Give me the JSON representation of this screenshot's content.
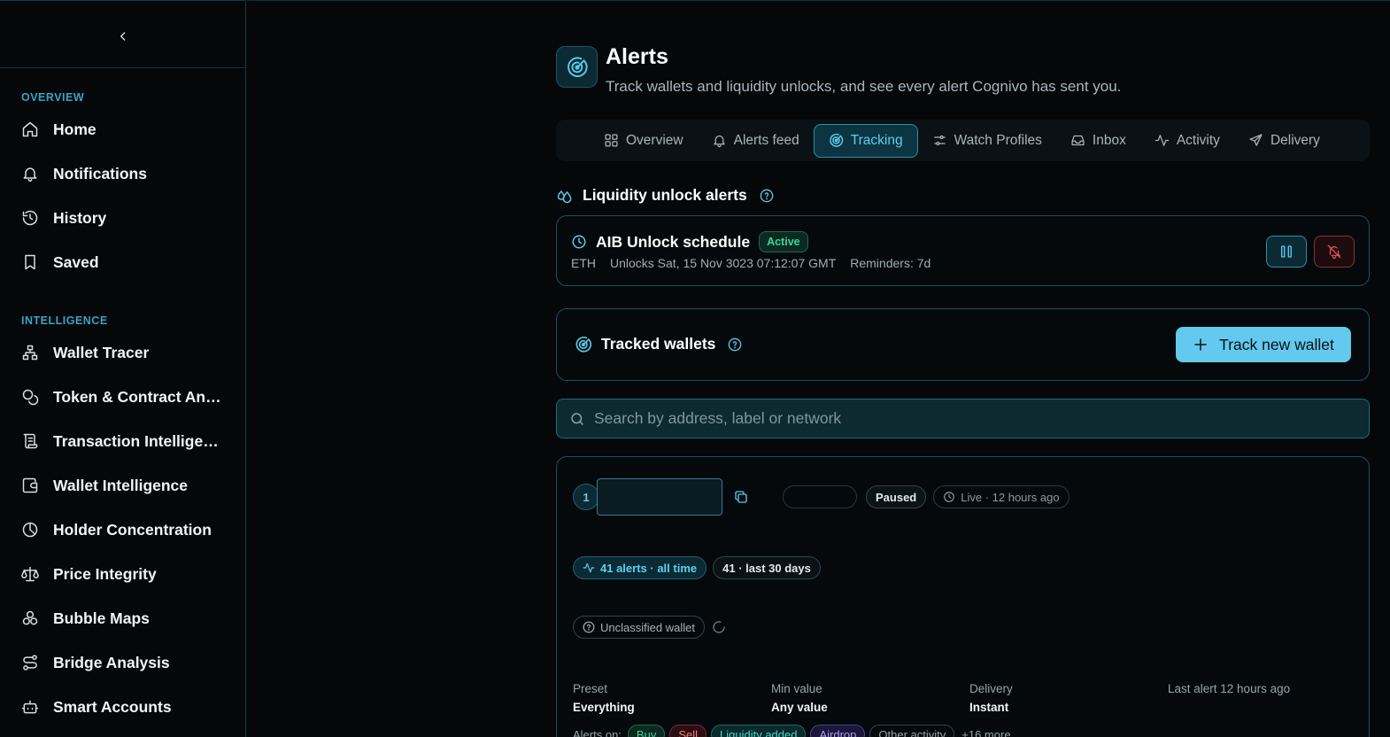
{
  "sidebar": {
    "collapse_icon": "chevron-left-icon",
    "sections": [
      {
        "title": "OVERVIEW",
        "items": [
          {
            "label": "Home",
            "icon": "home-icon"
          },
          {
            "label": "Notifications",
            "icon": "bell-icon"
          },
          {
            "label": "History",
            "icon": "history-icon"
          },
          {
            "label": "Saved",
            "icon": "bookmark-icon"
          }
        ]
      },
      {
        "title": "INTELLIGENCE",
        "items": [
          {
            "label": "Wallet Tracer",
            "icon": "network-icon"
          },
          {
            "label": "Token & Contract Analysis",
            "icon": "coins-icon"
          },
          {
            "label": "Transaction Intelligence",
            "icon": "scroll-icon"
          },
          {
            "label": "Wallet Intelligence",
            "icon": "wallet-icon"
          },
          {
            "label": "Holder Concentration",
            "icon": "pie-chart-icon"
          },
          {
            "label": "Price Integrity",
            "icon": "scale-icon"
          },
          {
            "label": "Bubble Maps",
            "icon": "bubbles-icon"
          },
          {
            "label": "Bridge Analysis",
            "icon": "route-icon"
          },
          {
            "label": "Smart Accounts",
            "icon": "bot-icon"
          }
        ]
      }
    ]
  },
  "header": {
    "icon": "radar-icon",
    "title": "Alerts",
    "subtitle": "Track wallets and liquidity unlocks, and see every alert Cognivo has sent you."
  },
  "tabs": [
    {
      "label": "Overview",
      "icon": "grid-icon"
    },
    {
      "label": "Alerts feed",
      "icon": "bell-icon"
    },
    {
      "label": "Tracking",
      "icon": "radar-icon",
      "active": true
    },
    {
      "label": "Watch Profiles",
      "icon": "sliders-icon"
    },
    {
      "label": "Inbox",
      "icon": "inbox-icon"
    },
    {
      "label": "Activity",
      "icon": "activity-icon"
    },
    {
      "label": "Delivery",
      "icon": "send-icon"
    }
  ],
  "liquidity": {
    "title": "Liquidity unlock alerts",
    "schedule": {
      "name": "AIB Unlock schedule",
      "status": "Active",
      "chain": "ETH",
      "unlocks": "Unlocks Sat, 15 Nov 3023 07:12:07 GMT",
      "reminders": "Reminders: 7d"
    }
  },
  "tracked": {
    "title": "Tracked wallets",
    "button_label": "Track new wallet"
  },
  "search": {
    "placeholder": "Search by address, label or network"
  },
  "wallet": {
    "index": "1",
    "status": "Paused",
    "live": "Live · 12 hours ago",
    "alerts_all": "41 alerts · all time",
    "alerts_30": "41 · last 30 days",
    "classification": "Unclassified wallet",
    "fields": [
      {
        "key": "Preset",
        "value": "Everything"
      },
      {
        "key": "Min value",
        "value": "Any value"
      },
      {
        "key": "Delivery",
        "value": "Instant"
      },
      {
        "key": "Last alert 12 hours ago",
        "value": ""
      }
    ],
    "alerts_on_label": "Alerts on:",
    "alert_tags": [
      "Buy",
      "Sell",
      "Liquidity added",
      "Airdrop",
      "Other activity"
    ],
    "more": "+16 more"
  },
  "colors": {
    "accent": "#5cc9ec",
    "button": "#63c9ef",
    "active_green": "#3ed598",
    "danger": "#e84d55"
  }
}
